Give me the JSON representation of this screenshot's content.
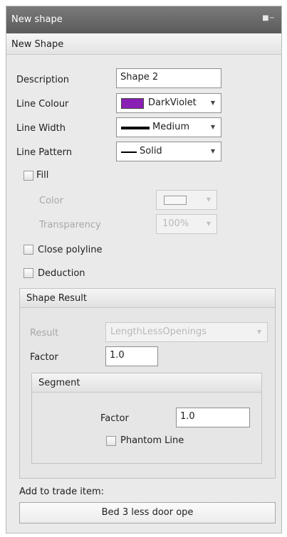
{
  "panel": {
    "title": "New shape",
    "pin_icon": "pin-icon"
  },
  "header": {
    "title": "New Shape"
  },
  "form": {
    "description": {
      "label": "Description",
      "value": "Shape 2"
    },
    "line_colour": {
      "label": "Line Colour",
      "value": "DarkViolet",
      "swatch_color": "#8a1fb5"
    },
    "line_width": {
      "label": "Line Width",
      "value": "Medium"
    },
    "line_pattern": {
      "label": "Line Pattern",
      "value": "Solid"
    },
    "fill": {
      "label": "Fill",
      "checked": false
    },
    "color": {
      "label": "Color"
    },
    "transparency": {
      "label": "Transparency",
      "value": "100%"
    },
    "close_polyline": {
      "label": "Close polyline",
      "checked": false
    },
    "deduction": {
      "label": "Deduction",
      "checked": false
    }
  },
  "shape_result": {
    "title": "Shape Result",
    "result": {
      "label": "Result",
      "value": "LengthLessOpenings"
    },
    "factor": {
      "label": "Factor",
      "value": "1.0"
    },
    "segment": {
      "title": "Segment",
      "factor": {
        "label": "Factor",
        "value": "1.0"
      },
      "phantom_line": {
        "label": "Phantom Line",
        "checked": false
      }
    }
  },
  "trade": {
    "label": "Add to trade item:",
    "button": "Bed 3 less door ope"
  }
}
